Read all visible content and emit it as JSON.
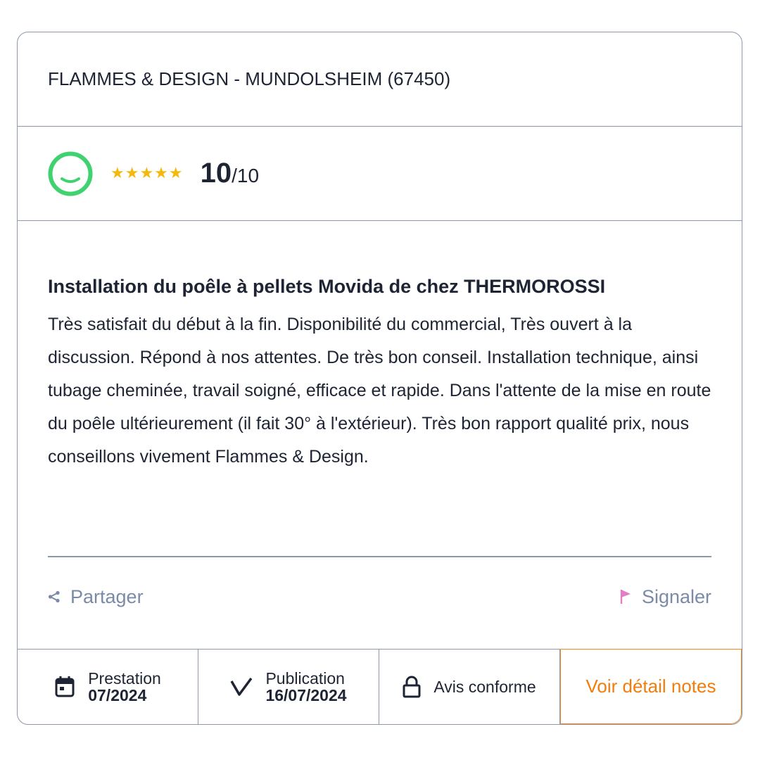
{
  "company": {
    "name": "FLAMMES & DESIGN  - MUNDOLSHEIM (67450)"
  },
  "rating": {
    "smiley_icon": "happy-face-icon",
    "stars": "★★★★★",
    "stars_count": 5,
    "score": "10",
    "score_max": "/10",
    "colors": {
      "smiley": "#3fd26e",
      "stars": "#f5b90c"
    }
  },
  "review": {
    "title": "Installation du poêle à pellets Movida de chez THERMOROSSI",
    "text": "Très satisfait du début à la fin. Disponibilité du commercial, Très ouvert à la discussion. Répond à nos attentes. De très bon conseil. Installation technique, ainsi tubage cheminée, travail soigné, efficace et rapide. Dans l'attente de la mise en route du poêle ultérieurement (il fait 30° à l'extérieur). Très bon rapport qualité prix, nous conseillons vivement Flammes & Design."
  },
  "actions": {
    "share_label": "Partager",
    "share_icon": "share-icon",
    "report_label": "Signaler",
    "report_icon": "flag-icon",
    "colors": {
      "text": "#7a8aa8",
      "flag": "#e27fc4"
    }
  },
  "footer": {
    "prestation_label": "Prestation",
    "prestation_value": "07/2024",
    "prestation_icon": "calendar-icon",
    "publication_label": "Publication",
    "publication_value": "16/07/2024",
    "publication_icon": "checkmark-icon",
    "conform_label": "Avis conforme",
    "conform_icon": "lock-icon",
    "detail_button": "Voir détail notes",
    "colors": {
      "accent": "#f07d0e"
    }
  }
}
